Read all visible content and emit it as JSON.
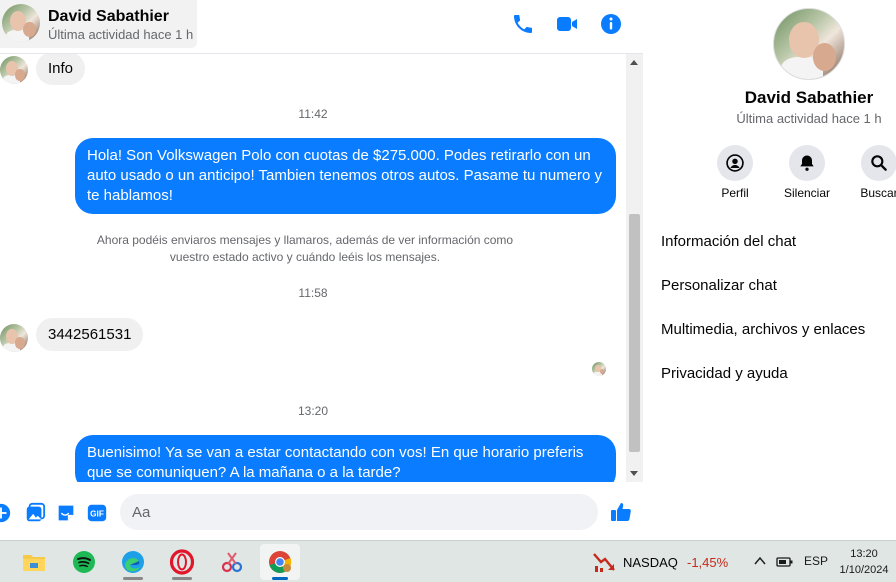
{
  "header": {
    "name": "David Sabathier",
    "status": "Última actividad hace 1 h"
  },
  "messages": {
    "info_label": "Info",
    "time1": "11:42",
    "out1": "Hola! Son Volkswagen Polo con cuotas de $275.000. Podes retirarlo con un auto usado o un anticipo! Tambien tenemos otros autos. Pasame tu numero y te hablamos!",
    "system_notice": "Ahora podéis enviaros mensajes y llamaros, además de ver información como vuestro estado activo y cuándo leéis los mensajes.",
    "time2": "11:58",
    "in_phone": "3442561531",
    "time3": "13:20",
    "out2": "Buenisimo! Ya se van a estar contactando con vos! En que horario preferis que se comuniquen? A la mañana o a la tarde?"
  },
  "composer": {
    "placeholder": "Aa"
  },
  "side": {
    "name": "David Sabathier",
    "status": "Última actividad hace 1 h",
    "actions": [
      {
        "label": "Perfil",
        "icon": "profile-icon"
      },
      {
        "label": "Silenciar",
        "icon": "bell-icon"
      },
      {
        "label": "Buscar",
        "icon": "search-icon"
      }
    ],
    "items": [
      "Información del chat",
      "Personalizar chat",
      "Multimedia, archivos y enlaces",
      "Privacidad y ayuda"
    ]
  },
  "taskbar": {
    "ticker": "NASDAQ",
    "ticker_change": "-1,45%",
    "lang": "ESP",
    "time": "13:20",
    "date": "1/10/2024"
  },
  "colors": {
    "accent": "#0a7cff",
    "bubble_in": "#f0f0f0",
    "negative": "#c42b1c"
  }
}
